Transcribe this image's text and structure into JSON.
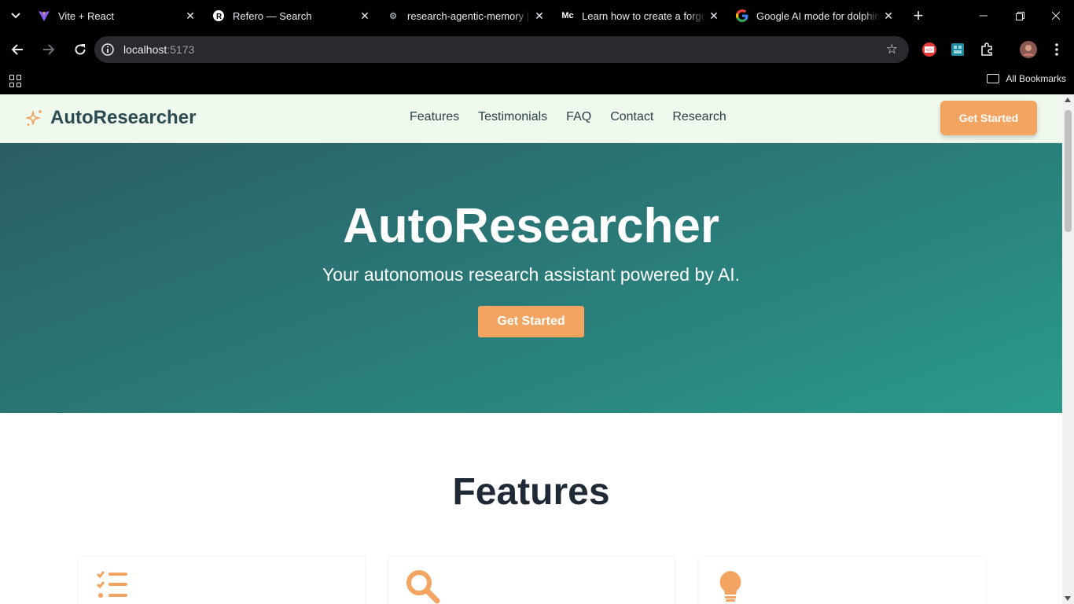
{
  "browser": {
    "tabs": [
      {
        "title": "Vite + React",
        "favicon": "vite-icon"
      },
      {
        "title": "Refero — Search",
        "favicon": "refero-icon"
      },
      {
        "title": "research-agentic-memory | R",
        "favicon": "gear-icon"
      },
      {
        "title": "Learn how to create a forgot",
        "favicon": "medium-icon"
      },
      {
        "title": "Google AI mode for dolphin",
        "favicon": "google-icon"
      }
    ],
    "address": {
      "host": "localhost",
      "port": ":5173"
    },
    "bookmarks_label": "All Bookmarks",
    "icons": {
      "back": "arrow-left-icon",
      "forward": "arrow-right-icon",
      "reload": "reload-icon",
      "new_tab": "plus-icon"
    }
  },
  "site": {
    "brand": "AutoResearcher",
    "menu": [
      "Features",
      "Testimonials",
      "FAQ",
      "Contact",
      "Research"
    ],
    "nav_cta": "Get Started",
    "hero": {
      "title": "AutoResearcher",
      "subtitle": "Your autonomous research assistant powered by AI.",
      "cta": "Get Started"
    },
    "features_title": "Features",
    "feature_icons": [
      "checklist-icon",
      "magnifier-icon",
      "lightbulb-icon"
    ],
    "colors": {
      "accent": "#f3a460",
      "nav_bg": "#f0f9ee",
      "hero_start": "#2a5d66",
      "hero_end": "#2a9a8b",
      "heading": "#1f2a36"
    }
  }
}
